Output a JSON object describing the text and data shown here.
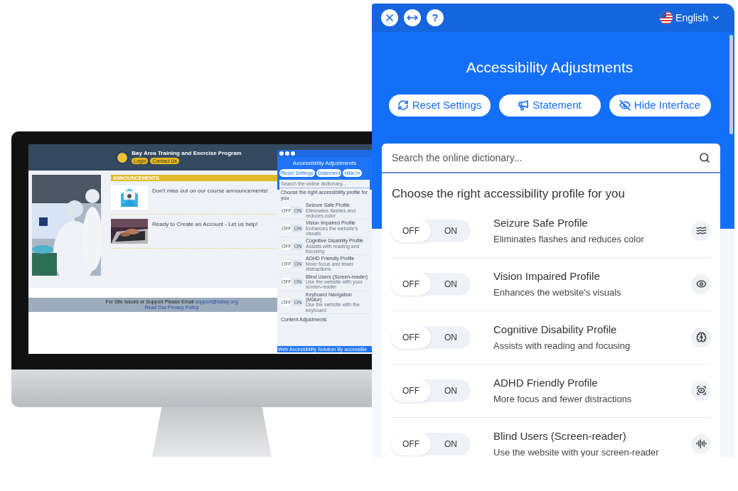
{
  "website": {
    "title": "Bay Area Training and Exercise Program",
    "nav_buttons": [
      "Login",
      "Contact Us"
    ],
    "section_heading": "ANNOUNCEMENTS",
    "announcements": [
      {
        "text": "Don't miss out on our course announcements!",
        "kind": "envelope"
      },
      {
        "text": "Ready to Create an Account - Let us help!",
        "kind": "laptop"
      }
    ],
    "footer": {
      "text": "For Site Issues or Support Please Email",
      "email": "support@batep.org",
      "link": "Read Our Privacy Policy"
    },
    "mini_panel": {
      "title": "Accessibility Adjustments",
      "buttons": [
        "Reset Settings",
        "Statement",
        "Hide In"
      ],
      "search": {
        "placeholder": "Search the online dictionary..."
      },
      "heading": "Choose the right accessibility profile for you",
      "profiles": [
        {
          "name": "Seizure Safe Profile",
          "description": "Eliminates flashes and reduces color",
          "on": false,
          "off_label": "OFF",
          "on_label": "ON"
        },
        {
          "name": "Vision Impaired Profile",
          "description": "Enhances the website's visuals",
          "on": false,
          "off_label": "OFF",
          "on_label": "ON"
        },
        {
          "name": "Cognitive Disability Profile",
          "description": "Assists with reading and focusing",
          "on": false,
          "off_label": "OFF",
          "on_label": "ON"
        },
        {
          "name": "ADHD Friendly Profile",
          "description": "More focus and fewer distractions",
          "on": false,
          "off_label": "OFF",
          "on_label": "ON"
        },
        {
          "name": "Blind Users (Screen-reader)",
          "description": "Use the website with your screen-reader",
          "on": false,
          "off_label": "OFF",
          "on_label": "ON"
        },
        {
          "name": "Keyboard Navigation (Motor)",
          "description": "Use the website with the keyboard",
          "on": false,
          "off_label": "OFF",
          "on_label": "ON"
        }
      ],
      "section": "Content Adjustments",
      "footer": "Web Accessibility Solution By accessiBe"
    }
  },
  "panel": {
    "header_buttons": [
      "?"
    ],
    "language": "English",
    "title": "Accessibility Adjustments",
    "buttons": [
      {
        "label": "Reset Settings",
        "kind": "reset"
      },
      {
        "label": "Statement",
        "kind": "statement"
      },
      {
        "label": "Hide Interface",
        "kind": "hide"
      }
    ],
    "search": {
      "placeholder": "Search the online dictionary..."
    },
    "heading": "Choose the right accessibility profile for you",
    "profiles": [
      {
        "name": "Seizure Safe Profile",
        "description": "Eliminates flashes and reduces color",
        "on": false,
        "kind": "seizure",
        "off_label": "OFF",
        "on_label": "ON"
      },
      {
        "name": "Vision Impaired Profile",
        "description": "Enhances the website's visuals",
        "on": false,
        "kind": "vision",
        "off_label": "OFF",
        "on_label": "ON"
      },
      {
        "name": "Cognitive Disability Profile",
        "description": "Assists with reading and focusing",
        "on": false,
        "kind": "cognitive",
        "off_label": "OFF",
        "on_label": "ON"
      },
      {
        "name": "ADHD Friendly Profile",
        "description": "More focus and fewer distractions",
        "on": false,
        "kind": "adhd",
        "off_label": "OFF",
        "on_label": "ON"
      },
      {
        "name": "Blind Users (Screen-reader)",
        "description": "Use the website with your screen-reader",
        "on": false,
        "kind": "blind",
        "off_label": "OFF",
        "on_label": "ON"
      }
    ]
  }
}
